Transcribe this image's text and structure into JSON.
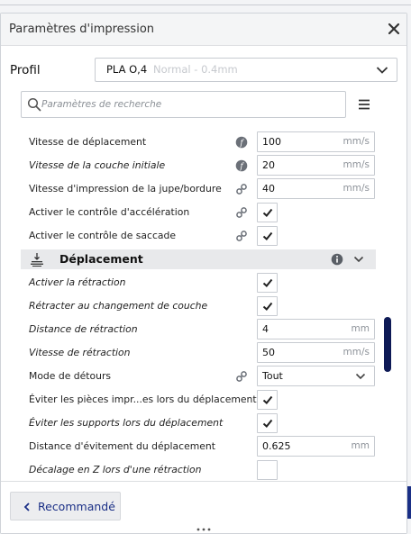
{
  "panel": {
    "title": "Paramètres d'impression"
  },
  "profile": {
    "label": "Profil",
    "name": "PLA O,4",
    "sub": "Normal - 0.4mm"
  },
  "search": {
    "placeholder": "Paramètres de recherche"
  },
  "rows_top": [
    {
      "label": "Vitesse de déplacement",
      "icon": "function-icon",
      "value": "100",
      "unit": "mm/s",
      "italic": false
    },
    {
      "label": "Vitesse de la couche initiale",
      "icon": "function-icon",
      "value": "20",
      "unit": "mm/s",
      "italic": true
    },
    {
      "label": "Vitesse d'impression de la jupe/bordure",
      "icon": "link-icon",
      "value": "40",
      "unit": "mm/s",
      "italic": false
    },
    {
      "label": "Activer le contrôle d'accélération",
      "icon": "link-icon",
      "checked": true
    },
    {
      "label": "Activer le contrôle de saccade",
      "icon": "link-icon",
      "checked": true
    }
  ],
  "category": {
    "label": "Déplacement",
    "icon": "travel-icon"
  },
  "rows_bottom": [
    {
      "label": "Activer la rétraction",
      "checked": true,
      "italic": true
    },
    {
      "label": "Rétracter au changement de couche",
      "checked": true,
      "italic": true
    },
    {
      "label": "Distance de rétraction",
      "value": "4",
      "unit": "mm",
      "italic": true
    },
    {
      "label": "Vitesse de rétraction",
      "value": "50",
      "unit": "mm/s",
      "italic": true
    },
    {
      "label": "Mode de détours",
      "icon": "link-icon",
      "select": "Tout",
      "italic": false
    },
    {
      "label": "Éviter les pièces impr...es lors du déplacement",
      "checked": true,
      "italic": false
    },
    {
      "label": "Éviter les supports lors du déplacement",
      "checked": true,
      "italic": true
    },
    {
      "label": "Distance d'évitement du déplacement",
      "value": "0.625",
      "unit": "mm",
      "italic": false
    },
    {
      "label": "Décalage en Z lors d'une rétraction",
      "checked": false,
      "italic": true
    }
  ],
  "footer": {
    "recommended_label": "Recommandé"
  },
  "colors": {
    "accent": "#1a2f86",
    "scrollbar": "#0e1a56",
    "category_bg": "#e8e9eb"
  }
}
